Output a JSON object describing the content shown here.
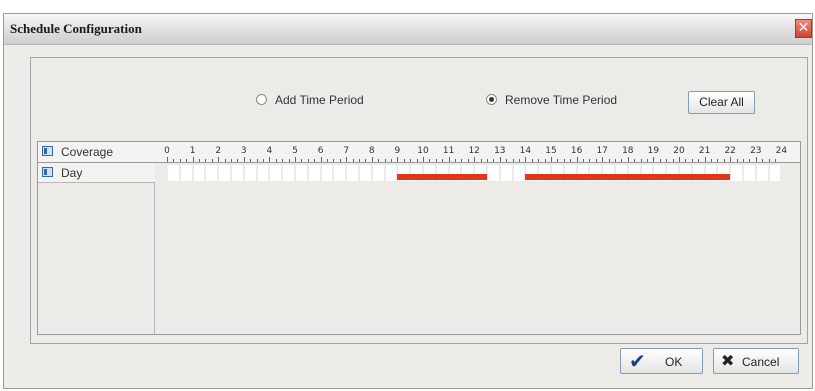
{
  "dialog": {
    "title": "Schedule Configuration",
    "close_symbol": "✕"
  },
  "mode": {
    "add_label": "Add Time Period",
    "remove_label": "Remove Time Period",
    "selected": "remove"
  },
  "clear_all_label": "Clear All",
  "grid": {
    "header_label": "Coverage",
    "rows": [
      {
        "label": "Day"
      }
    ],
    "hours": [
      "0",
      "1",
      "2",
      "3",
      "4",
      "5",
      "6",
      "7",
      "8",
      "9",
      "10",
      "11",
      "12",
      "13",
      "14",
      "15",
      "16",
      "17",
      "18",
      "19",
      "20",
      "21",
      "22",
      "23",
      "24"
    ],
    "scheduled_periods": [
      {
        "start_hour": 9.0,
        "end_hour": 12.5
      },
      {
        "start_hour": 14.0,
        "end_hour": 22.0
      }
    ]
  },
  "ok_label": "OK",
  "cancel_label": "Cancel",
  "colors": {
    "period": "#e2351a",
    "ok_check": "#1a3e8c",
    "cancel_x": "#222222"
  },
  "icons": {
    "close": "close-icon",
    "coverage": "coverage-icon",
    "day": "day-icon",
    "ok": "checkmark-icon",
    "cancel": "x-icon"
  }
}
